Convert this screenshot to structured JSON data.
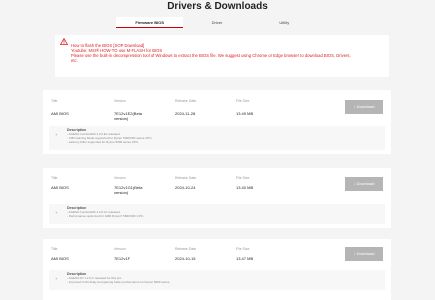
{
  "page": {
    "title": "Drivers & Downloads"
  },
  "tabs": [
    {
      "label": "Firmware BIOS",
      "active": true
    },
    {
      "label": "Driver",
      "active": false
    },
    {
      "label": "Utility",
      "active": false
    }
  ],
  "notice": {
    "icon": "warning-icon",
    "line1": "How to flash the BIOS [SOP Download]",
    "line2": "Youtube: MSI® HOW-TO use M-FLASH for BIOS",
    "line3": "Please use the built-in decompression tool of Windows to extract the BIOS file. We suggest using Chrome or Edge browser to download BIOS, Drivers,",
    "line4": "etc.",
    "color": "#dd2222"
  },
  "labels": {
    "title": "Title",
    "version": "Version",
    "release": "Release Date",
    "size": "File Size",
    "download": "↓ Download",
    "description": "Description"
  },
  "downloads": [
    {
      "title": "AMI BIOS",
      "version_l1": "7E12v1E2(Beta",
      "version_l2": "version)",
      "release": "2024-11-28",
      "size": "13.49 MB",
      "desc": [
        "- AGESA ComboAM4 1.2.0.Ec released.",
        "- X3D Gaming Mode supported for Ryzen 5000X3D series CPU.",
        "- Latency Killer supported for Ryzen 5000 series CPU."
      ]
    },
    {
      "title": "AMI BIOS",
      "version_l1": "7E12v1G1(Beta",
      "version_l2": "version)",
      "release": "2024-10-24",
      "size": "13.40 MB",
      "desc": [
        "- AGESA ComboAM4 1.2.0.Cc released.",
        "- Performance optimized for AMD Ryzen7 5800X3D CPU."
      ]
    },
    {
      "title": "AMI BIOS",
      "version_l1": "7E12v1F",
      "version_l2": "",
      "release": "2024-10-15",
      "size": "13.47 MB",
      "desc": [
        "- AGESA FP 1.2.0.C released for this pro.",
        "- Improved CCD delay and gaming better performance for Ryzen 5000 series."
      ]
    }
  ]
}
